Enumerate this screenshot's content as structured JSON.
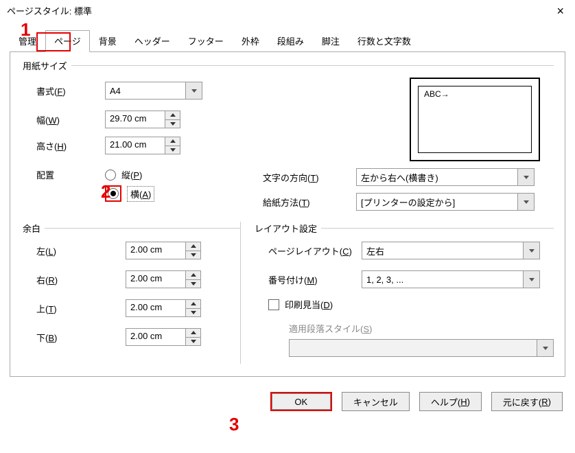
{
  "window": {
    "title": "ページスタイル: 標準"
  },
  "tabs": [
    "管理",
    "ページ",
    "背景",
    "ヘッダー",
    "フッター",
    "外枠",
    "段組み",
    "脚注",
    "行数と文字数"
  ],
  "active_tab": 1,
  "paper": {
    "legend": "用紙サイズ",
    "format_label_pre": "書式(",
    "format_u": "F",
    "format_label_post": ")",
    "format_value": "A4",
    "width_label_pre": "幅(",
    "width_u": "W",
    "width_label_post": ")",
    "width_value": "29.70 cm",
    "height_label_pre": "高さ(",
    "height_u": "H",
    "height_label_post": ")",
    "height_value": "21.00 cm",
    "orient_label": "配置",
    "portrait_pre": "縦(",
    "portrait_u": "P",
    "portrait_post": ")",
    "landscape_pre": "横(",
    "landscape_u": "A",
    "landscape_post": ")",
    "orientation": "landscape"
  },
  "preview_text": "ABC→",
  "textdir": {
    "label_pre": "文字の方向(",
    "u": "T",
    "label_post": ")",
    "value": "左から右へ(横書き)"
  },
  "tray": {
    "label_pre": "給紙方法(",
    "u": "T",
    "label_post": ")",
    "value": "[プリンターの設定から]"
  },
  "margins": {
    "legend": "余白",
    "left_pre": "左(",
    "left_u": "L",
    "left_post": ")",
    "left_value": "2.00 cm",
    "right_pre": "右(",
    "right_u": "R",
    "right_post": ")",
    "right_value": "2.00 cm",
    "top_pre": "上(",
    "top_u": "T",
    "top_post": ")",
    "top_value": "2.00 cm",
    "bottom_pre": "下(",
    "bottom_u": "B",
    "bottom_post": ")",
    "bottom_value": "2.00 cm"
  },
  "layout": {
    "legend": "レイアウト設定",
    "pagelayout_pre": "ページレイアウト(",
    "pagelayout_u": "C",
    "pagelayout_post": ")",
    "pagelayout_value": "左右",
    "numbering_pre": "番号付け(",
    "numbering_u": "M",
    "numbering_post": ")",
    "numbering_value": "1, 2, 3, ...",
    "register_pre": "印刷見当(",
    "register_u": "D",
    "register_post": ")",
    "register_checked": false,
    "parastyle_pre": "適用段落スタイル(",
    "parastyle_u": "S",
    "parastyle_post": ")",
    "parastyle_value": ""
  },
  "buttons": {
    "ok": "OK",
    "cancel": "キャンセル",
    "help_pre": "ヘルプ(",
    "help_u": "H",
    "help_post": ")",
    "reset_pre": "元に戻す(",
    "reset_u": "R",
    "reset_post": ")"
  },
  "annotations": {
    "a1": "1",
    "a2": "2",
    "a3": "3"
  }
}
